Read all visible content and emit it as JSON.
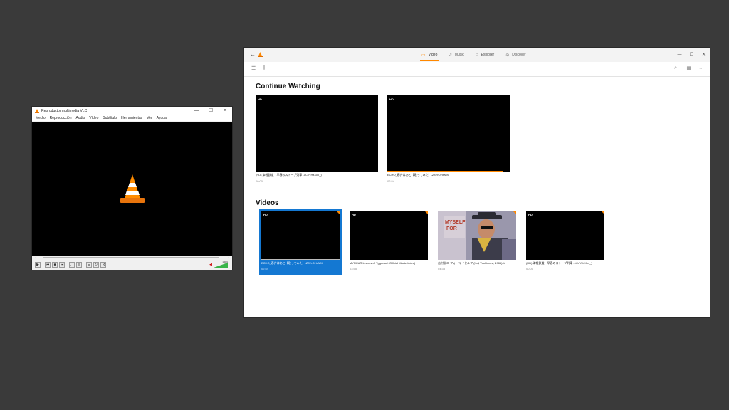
{
  "vlc": {
    "title": "Reproductor multimedia VLC",
    "menu": [
      "Medio",
      "Reproducción",
      "Audio",
      "Vídeo",
      "Subtítulo",
      "Herramientas",
      "Ver",
      "Ayuda"
    ],
    "time_left": "-:--",
    "time_right": "-:--",
    "volume": "100%",
    "volume_level": 1.0
  },
  "app": {
    "tabs": [
      {
        "label": "Video",
        "icon": "video-icon"
      },
      {
        "label": "Music",
        "icon": "music-icon"
      },
      {
        "label": "Explorer",
        "icon": "explorer-icon"
      },
      {
        "label": "Discover",
        "icon": "discover-icon"
      }
    ],
    "active_tab": "Video",
    "accent_color": "#ff8800",
    "selection_color": "#1478d2",
    "continue_watching": {
      "title": "Continue Watching",
      "items": [
        {
          "badge": "HD",
          "title": "(HD) 津軽鉄道　早春のストーブ列車 -1CxYHzXcv_)",
          "duration": "00:00",
          "progress": 0.0
        },
        {
          "badge": "HD",
          "title": "ECHO_春井はあと【歌ってみた】-Z8Yn0HxN90",
          "duration": "02:54",
          "progress": 0.95
        }
      ]
    },
    "videos": {
      "title": "Videos",
      "items": [
        {
          "badge": "HD",
          "title": "ECHO_春井はあと【歌ってみた】-Z8Yn0HxN90",
          "duration": "02:54",
          "selected": true
        },
        {
          "badge": "HD",
          "title": "MYRKUR Leaves of Yggdrasil (Official Music Video)",
          "duration": "03:55",
          "selected": false
        },
        {
          "badge": "",
          "title": "吉村弘二 フォーマイセルフ (Koji Yoshimura, 1985)-V",
          "duration": "04:33",
          "selected": false
        },
        {
          "badge": "HD",
          "title": "(HD) 津軽鉄道　早春のストーブ列車 -1CxYHzXcv_)",
          "duration": "00:00",
          "selected": false
        }
      ]
    }
  }
}
